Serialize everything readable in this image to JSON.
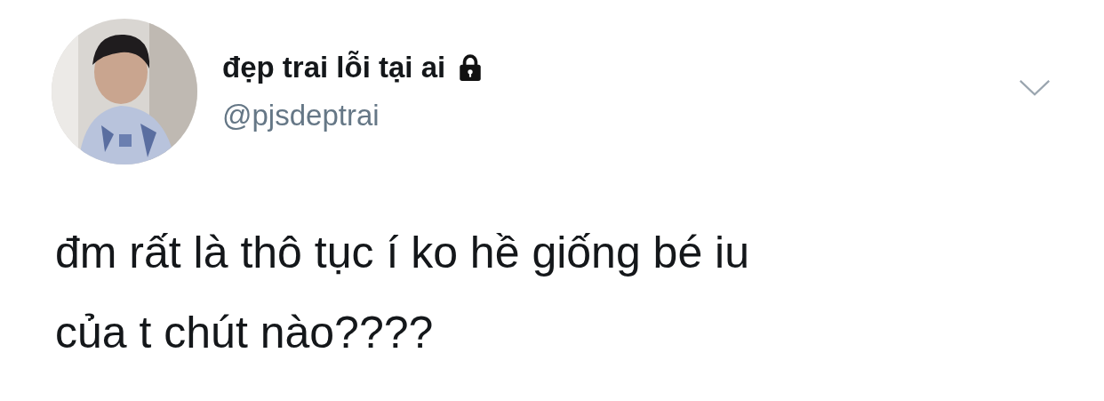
{
  "tweet": {
    "author": {
      "name": "đẹp trai lỗi tại ai",
      "protected": true,
      "handle": "@pjsdeptrai"
    },
    "text": [
      "đm rất là thô tục í ko hề giống bé iu",
      "của t chút nào????"
    ]
  }
}
